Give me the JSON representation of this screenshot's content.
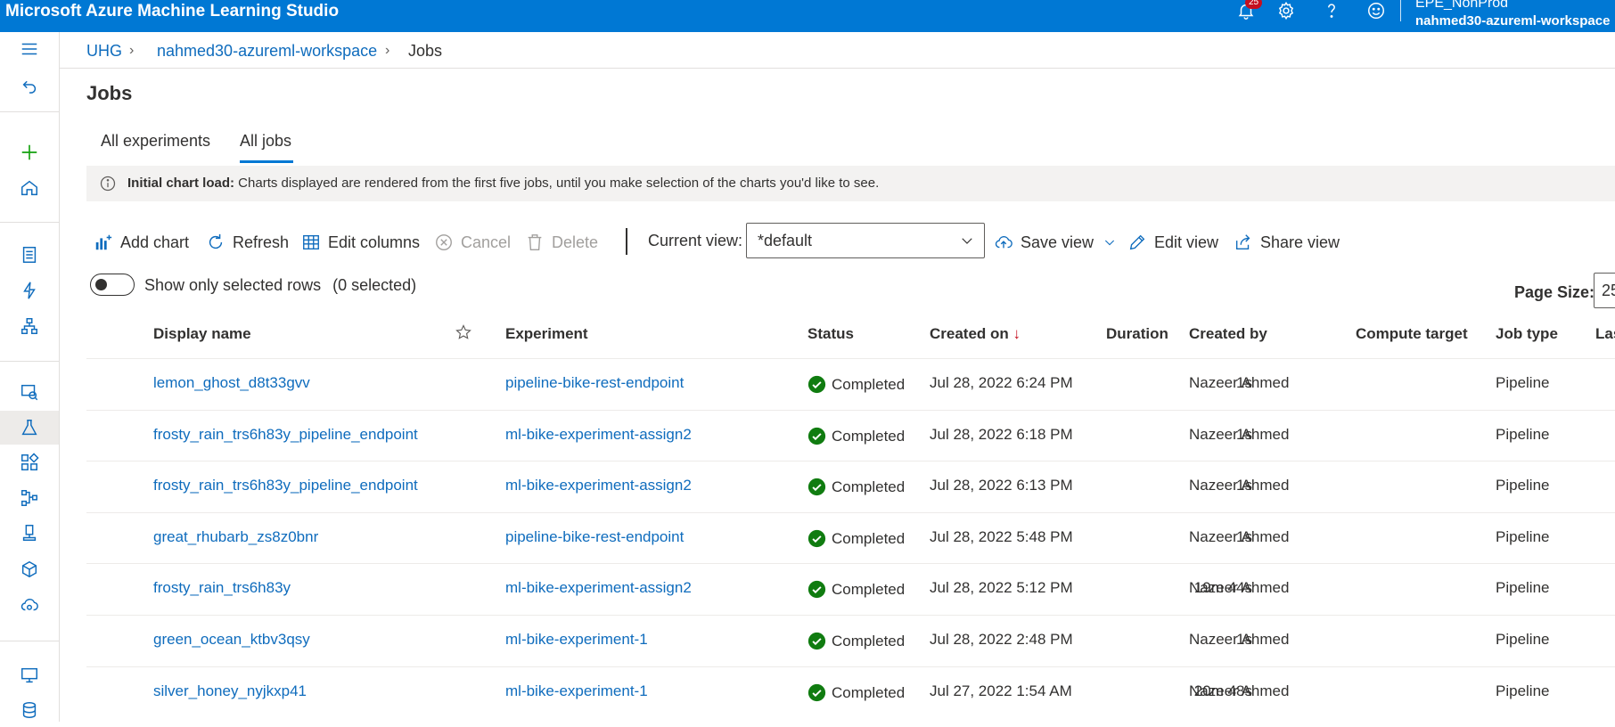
{
  "app": {
    "title": "Microsoft Azure Machine Learning Studio",
    "notification_count": "25"
  },
  "account": {
    "directory": "EPE_NonProd",
    "workspace": "nahmed30-azureml-workspace"
  },
  "breadcrumb": [
    "UHG",
    "nahmed30-azureml-workspace",
    "Jobs"
  ],
  "page": {
    "title": "Jobs"
  },
  "tabs": [
    {
      "label": "All experiments",
      "selected": false
    },
    {
      "label": "All jobs",
      "selected": true
    }
  ],
  "info": {
    "bold": "Initial chart load:",
    "text": " Charts displayed are rendered from the first five jobs, until you make selection of the charts you'd like to see."
  },
  "toolbar": {
    "add_chart": "Add chart",
    "refresh": "Refresh",
    "edit_columns": "Edit columns",
    "cancel": "Cancel",
    "delete": "Delete",
    "current_view_label": "Current view:",
    "current_view_value": "*default",
    "save_view": "Save view",
    "edit_view": "Edit view",
    "share_view": "Share view"
  },
  "selection": {
    "toggle_label": "Show only selected rows",
    "count_text": "(0 selected)"
  },
  "pagination": {
    "page_size_label": "Page Size:",
    "page_size_value": "25"
  },
  "table": {
    "columns": {
      "display_name": "Display name",
      "experiment": "Experiment",
      "status": "Status",
      "created_on": "Created on",
      "created_on_sort": "↓",
      "duration": "Duration",
      "created_by": "Created by",
      "compute_target": "Compute target",
      "job_type": "Job type",
      "last": "Las"
    },
    "rows": [
      {
        "display_name": "lemon_ghost_d8t33gvv",
        "experiment": "pipeline-bike-rest-endpoint",
        "status": "Completed",
        "created_on": "Jul 28, 2022 6:24 PM",
        "duration": "1s",
        "created_by": "Nazeer Ahmed",
        "compute_target": "",
        "job_type": "Pipeline"
      },
      {
        "display_name": "frosty_rain_trs6h83y_pipeline_endpoint",
        "experiment": "ml-bike-experiment-assign2",
        "status": "Completed",
        "created_on": "Jul 28, 2022 6:18 PM",
        "duration": "1s",
        "created_by": "Nazeer Ahmed",
        "compute_target": "",
        "job_type": "Pipeline"
      },
      {
        "display_name": "frosty_rain_trs6h83y_pipeline_endpoint",
        "experiment": "ml-bike-experiment-assign2",
        "status": "Completed",
        "created_on": "Jul 28, 2022 6:13 PM",
        "duration": "1s",
        "created_by": "Nazeer Ahmed",
        "compute_target": "",
        "job_type": "Pipeline"
      },
      {
        "display_name": "great_rhubarb_zs8z0bnr",
        "experiment": "pipeline-bike-rest-endpoint",
        "status": "Completed",
        "created_on": "Jul 28, 2022 5:48 PM",
        "duration": "1s",
        "created_by": "Nazeer Ahmed",
        "compute_target": "",
        "job_type": "Pipeline"
      },
      {
        "display_name": "frosty_rain_trs6h83y",
        "experiment": "ml-bike-experiment-assign2",
        "status": "Completed",
        "created_on": "Jul 28, 2022 5:12 PM",
        "duration": "19m 44s",
        "created_by": "Nazeer Ahmed",
        "compute_target": "",
        "job_type": "Pipeline"
      },
      {
        "display_name": "green_ocean_ktbv3qsy",
        "experiment": "ml-bike-experiment-1",
        "status": "Completed",
        "created_on": "Jul 28, 2022 2:48 PM",
        "duration": "1s",
        "created_by": "Nazeer Ahmed",
        "compute_target": "",
        "job_type": "Pipeline"
      },
      {
        "display_name": "silver_honey_nyjkxp41",
        "experiment": "ml-bike-experiment-1",
        "status": "Completed",
        "created_on": "Jul 27, 2022 1:54 AM",
        "duration": "20m 48s",
        "created_by": "Nazeer Ahmed",
        "compute_target": "",
        "job_type": "Pipeline"
      }
    ]
  },
  "nav_icons": [
    "hamburger-icon",
    "back-icon",
    "plus-icon",
    "home-icon",
    "notebook-icon",
    "automl-icon",
    "designer-icon",
    "data-labeling-icon",
    "jobs-icon",
    "components-icon",
    "pipelines-icon",
    "environments-icon",
    "models-icon",
    "endpoints-icon",
    "compute-icon",
    "datastores-icon"
  ],
  "colors": {
    "brand": "#0078d4",
    "link": "#0f6cbd",
    "success": "#107c10",
    "add": "#13a10e",
    "sort_arrow": "#c50f1f"
  }
}
